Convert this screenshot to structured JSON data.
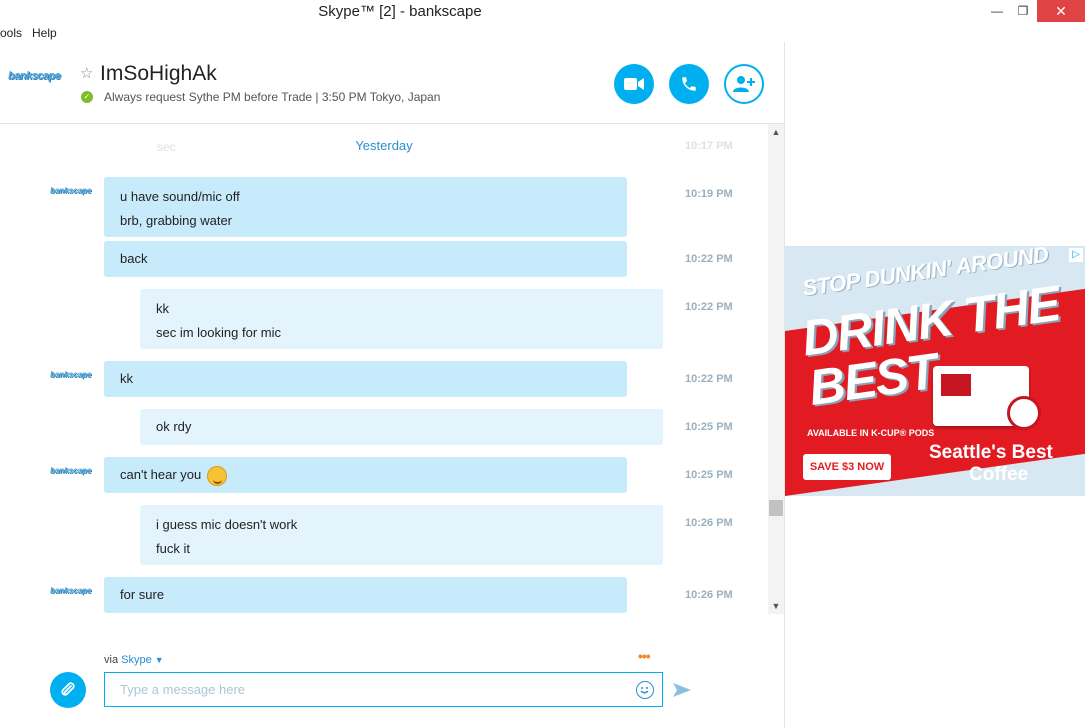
{
  "window": {
    "title": "Skype™ [2] - bankscape",
    "min_glyph": "—",
    "max_glyph": "❐",
    "close_glyph": "✕"
  },
  "menu": [
    {
      "label": "ools"
    },
    {
      "label": "Help"
    }
  ],
  "header": {
    "avatar_text": "bankscape",
    "name": "ImSoHighAk",
    "mood": "Always request Sythe PM before Trade | 3:50 PM Tokyo, Japan",
    "buttons": [
      "video-call",
      "voice-call",
      "add-people"
    ]
  },
  "conversation": {
    "faded_left": "sec",
    "faded_right": "10:17 PM",
    "day_separator": "Yesterday",
    "messages": [
      {
        "dir": "in",
        "lines": [
          "u have sound/mic off",
          "brb, grabbing water"
        ],
        "time": "10:19 PM",
        "avatar": true
      },
      {
        "dir": "in",
        "lines": [
          "back"
        ],
        "time": "10:22 PM",
        "avatar": false
      },
      {
        "dir": "out",
        "lines": [
          "kk",
          "sec im looking for mic"
        ],
        "time": "10:22 PM"
      },
      {
        "dir": "in",
        "lines": [
          "kk"
        ],
        "time": "10:22 PM",
        "avatar": true
      },
      {
        "dir": "out",
        "lines": [
          "ok rdy"
        ],
        "time": "10:25 PM"
      },
      {
        "dir": "in",
        "lines": [
          "can't hear you"
        ],
        "time": "10:25 PM",
        "avatar": true,
        "emoji": "smiley-tongue"
      },
      {
        "dir": "out",
        "lines": [
          "i guess mic doesn't work",
          "fuck it"
        ],
        "time": "10:26 PM"
      },
      {
        "dir": "in",
        "lines": [
          "for sure"
        ],
        "time": "10:26 PM",
        "avatar": true
      }
    ]
  },
  "compose": {
    "via_prefix": "via",
    "via_service": "Skype",
    "placeholder": "Type a message here",
    "value": "",
    "dots": "•••"
  },
  "ad": {
    "line1": "STOP DUNKIN' AROUND",
    "line2": "DRINK THE BEST",
    "kcup": "AVAILABLE IN K-CUP® PODS",
    "cta": "SAVE $3 NOW",
    "brand_line1": "Seattle's Best",
    "brand_line2": "Coffee",
    "info_glyph": "▷"
  },
  "colors": {
    "accent": "#00aff0",
    "bubble_in": "#c8ebfb",
    "bubble_out": "#e3f4fc",
    "ad_red": "#e21b23",
    "status_online": "#7cbd2a"
  }
}
